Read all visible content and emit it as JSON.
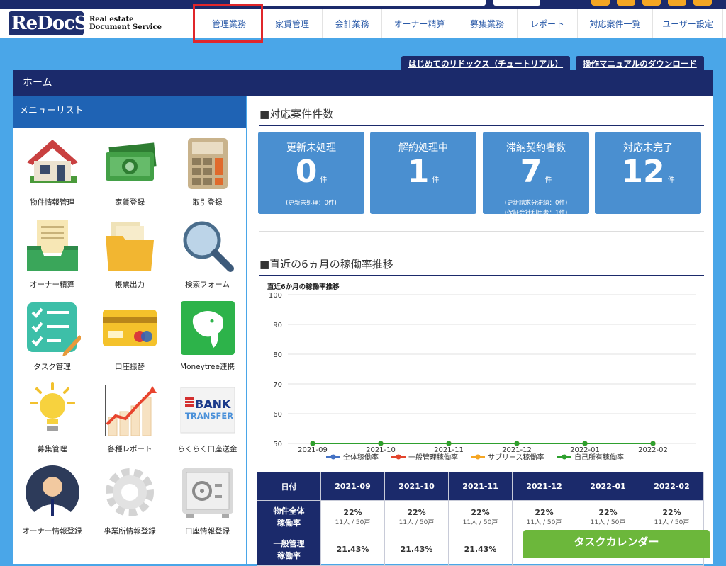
{
  "header": {
    "logo_main": "ReDocS",
    "logo_sub1": "Real estate",
    "logo_sub2": "Document Service"
  },
  "nav": [
    {
      "label": "管理業務",
      "w": 93
    },
    {
      "label": "家賃管理",
      "w": 85
    },
    {
      "label": "会計業務",
      "w": 84
    },
    {
      "label": "オーナー精算",
      "w": 106
    },
    {
      "label": "募集業務",
      "w": 85
    },
    {
      "label": "レポート",
      "w": 85
    },
    {
      "label": "対応案件一覧",
      "w": 106
    },
    {
      "label": "ユーザー設定",
      "w": 100
    }
  ],
  "help_buttons": {
    "tutorial": "はじめてのリドックス（チュートリアル）",
    "manual": "操作マニュアルのダウンロード"
  },
  "home_title": "ホーム",
  "menu": {
    "title": "メニューリスト",
    "items": [
      "物件情報管理",
      "家賃登録",
      "取引登録",
      "オーナー精算",
      "帳票出力",
      "検索フォーム",
      "タスク管理",
      "口座振替",
      "Moneytree連携",
      "募集管理",
      "各種レポート",
      "らくらく口座送金",
      "オーナー情報登録",
      "事業所情報登録",
      "口座情報登録"
    ],
    "bank_text1": "BANK",
    "bank_text2": "TRANSFER"
  },
  "cases": {
    "title": "■対応案件件数",
    "unit": "件",
    "cards": [
      {
        "title": "更新未処理",
        "value": "0",
        "sub1": "(更新未処理：0件)",
        "sub2": ""
      },
      {
        "title": "解約処理中",
        "value": "1",
        "sub1": "",
        "sub2": ""
      },
      {
        "title": "滞納契約者数",
        "value": "7",
        "sub1": "(更新請求分滞納：0件)",
        "sub2": "(保証会社利用者：1件)"
      },
      {
        "title": "対応未完了",
        "value": "12",
        "sub1": "",
        "sub2": ""
      }
    ]
  },
  "occupancy": {
    "title": "■直近の6ヵ月の稼働率推移"
  },
  "chart_data": {
    "type": "line",
    "title": "直近6か月の稼働率推移",
    "categories": [
      "2021-09",
      "2021-10",
      "2021-11",
      "2021-12",
      "2022-01",
      "2022-02"
    ],
    "ylim": [
      50,
      100
    ],
    "yticks": [
      50,
      60,
      70,
      80,
      90,
      100
    ],
    "series": [
      {
        "name": "全体稼働率",
        "color": "#4472c4",
        "values": [
          50,
          50,
          50,
          50,
          50,
          50
        ]
      },
      {
        "name": "一般管理稼働率",
        "color": "#e3452d",
        "values": [
          50,
          50,
          50,
          50,
          50,
          50
        ]
      },
      {
        "name": "サブリース稼働率",
        "color": "#f5a623",
        "values": [
          50,
          50,
          50,
          50,
          50,
          50
        ]
      },
      {
        "name": "自己所有稼働率",
        "color": "#2ea02e",
        "values": [
          50,
          50,
          50,
          50,
          50,
          50
        ]
      }
    ],
    "legend": "bottom"
  },
  "table": {
    "date_label": "日付",
    "row1_label1": "物件全体",
    "row1_label2": "稼働率",
    "row2_label1": "一般管理",
    "row2_label2": "稼働率",
    "row1": [
      {
        "pct": "22%",
        "sub": "11人 / 50戸"
      },
      {
        "pct": "22%",
        "sub": "11人 / 50戸"
      },
      {
        "pct": "22%",
        "sub": "11人 / 50戸"
      },
      {
        "pct": "22%",
        "sub": "11人 / 50戸"
      },
      {
        "pct": "22%",
        "sub": "11人 / 50戸"
      },
      {
        "pct": "22%",
        "sub": "11人 / 50戸"
      }
    ],
    "row2": [
      "21.43%",
      "21.43%",
      "21.43%",
      "",
      "",
      ""
    ]
  },
  "calendar_button": "タスクカレンダー"
}
